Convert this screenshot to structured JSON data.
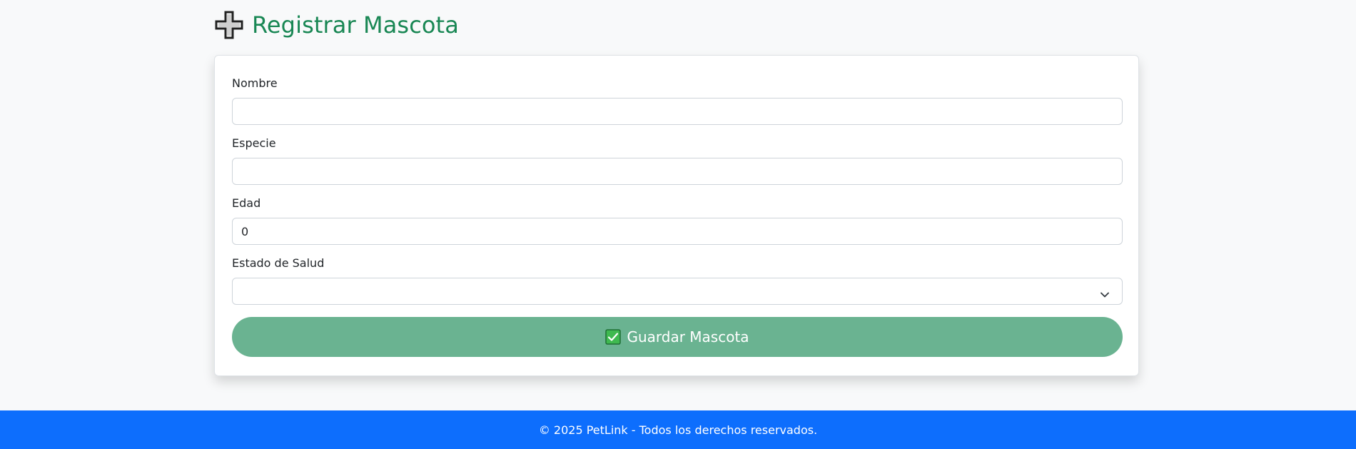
{
  "header": {
    "title": "Registrar Mascota",
    "icon": "plus-icon"
  },
  "form": {
    "fields": [
      {
        "label": "Nombre",
        "value": ""
      },
      {
        "label": "Especie",
        "value": ""
      },
      {
        "label": "Edad",
        "value": "0"
      },
      {
        "label": "Estado de Salud",
        "value": ""
      }
    ],
    "submit_label": "Guardar Mascota",
    "submit_icon": "check-icon"
  },
  "footer": {
    "text": "© 2025 PetLink - Todos los derechos reservados."
  },
  "colors": {
    "title": "#198754",
    "button": "#6ab391",
    "footer": "#0d6efd",
    "check_box": "#3fb950"
  }
}
